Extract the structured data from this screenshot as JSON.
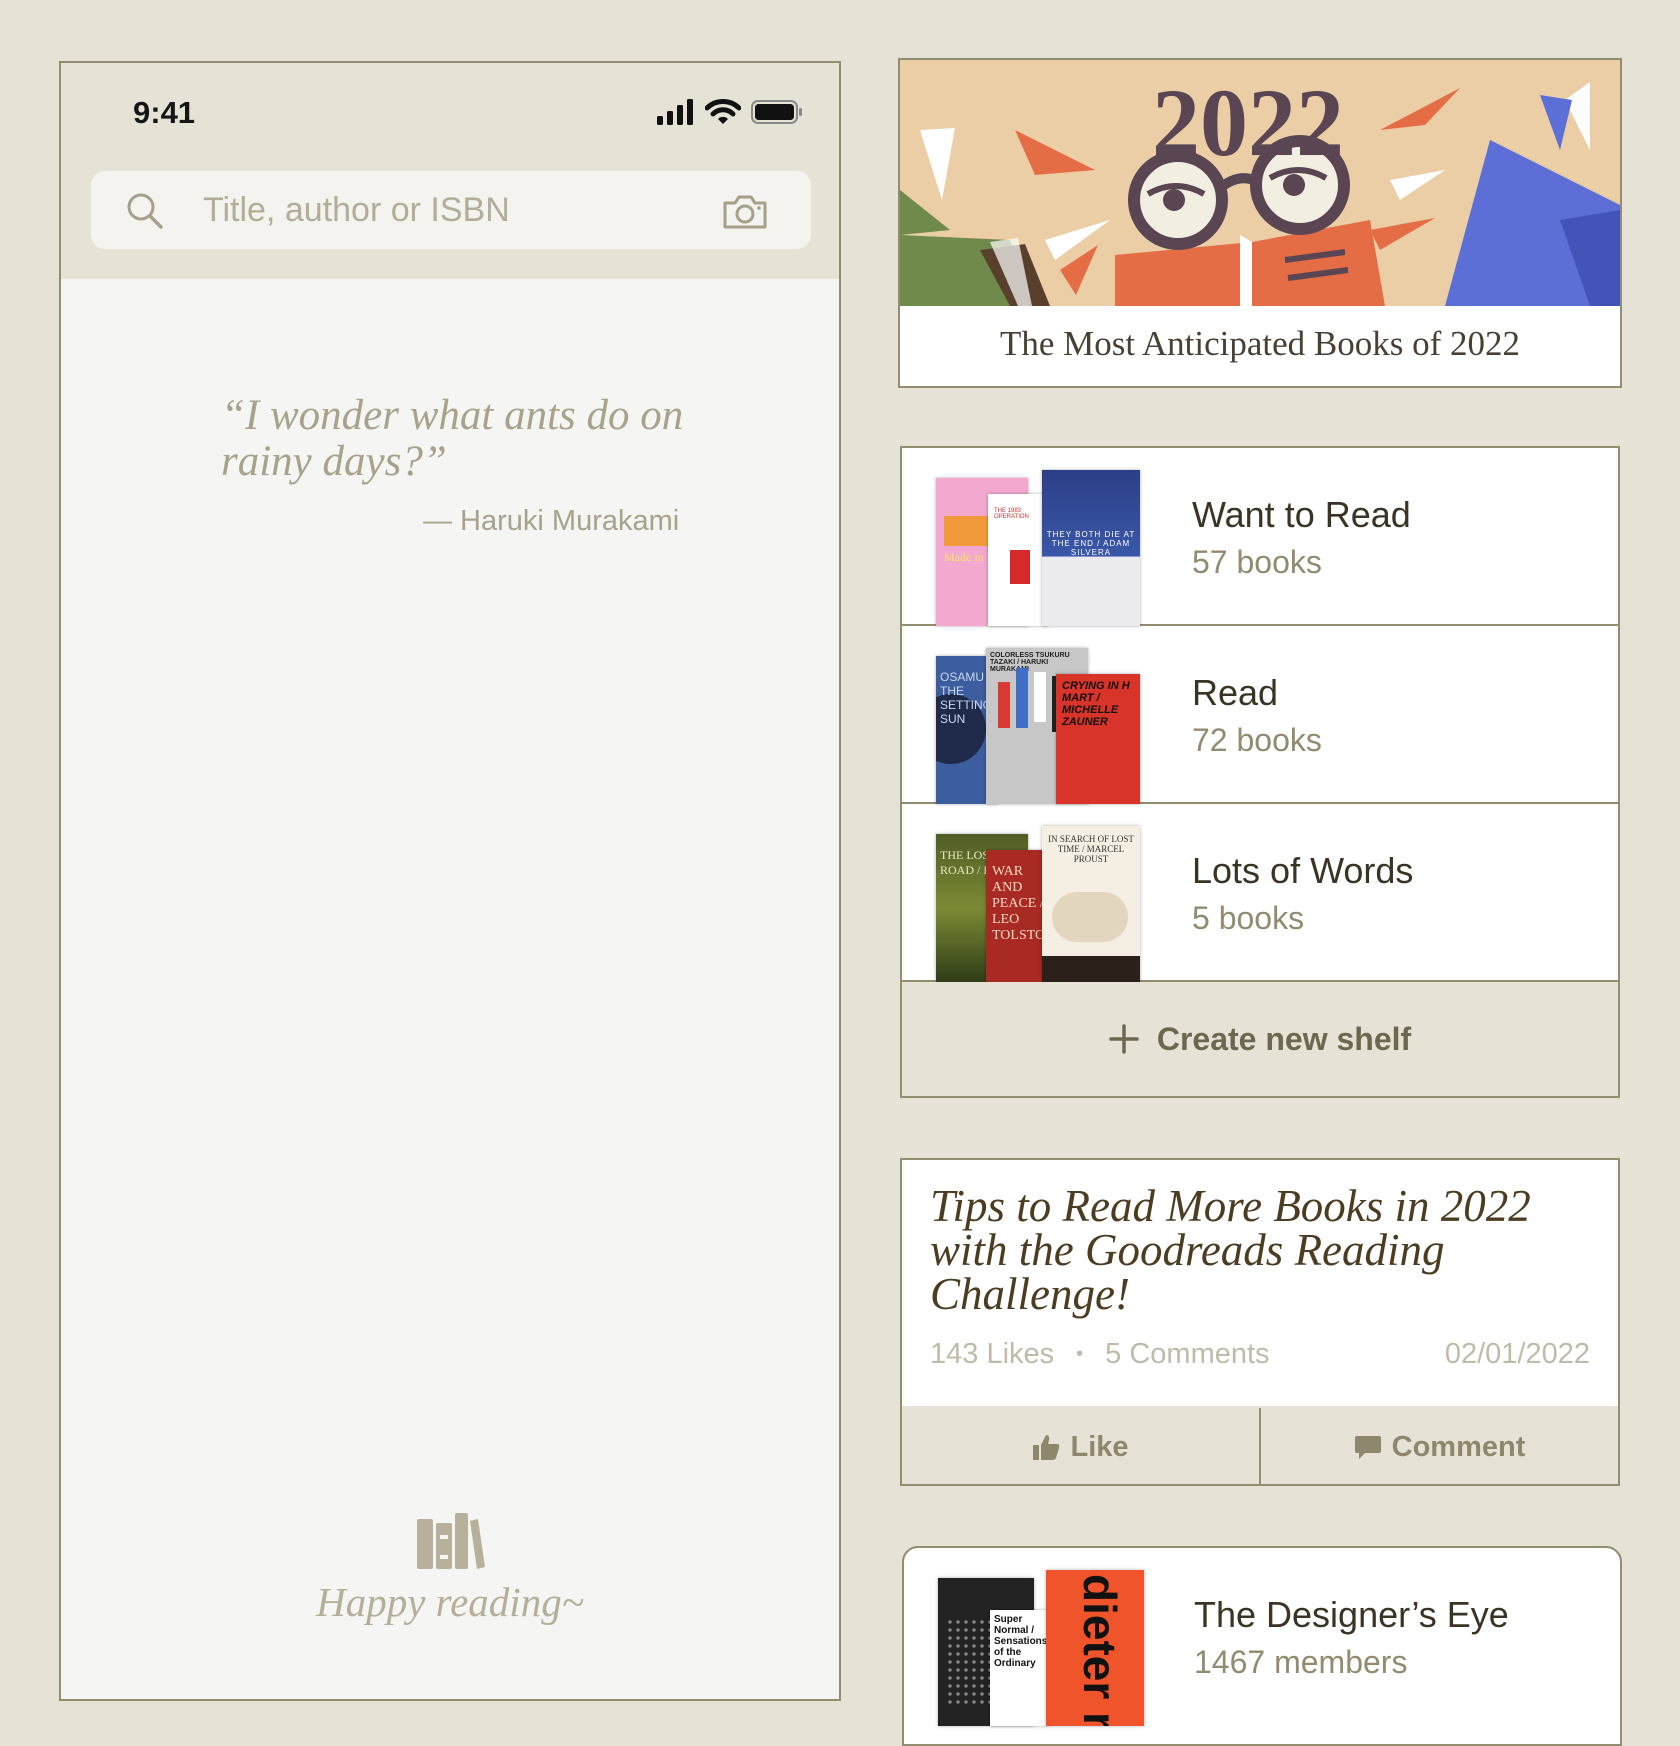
{
  "status_bar": {
    "time": "9:41"
  },
  "search": {
    "placeholder": "Title, author or ISBN"
  },
  "quote": {
    "text": "“I wonder what ants do on rainy days?”",
    "author": "— Haruki Murakami"
  },
  "footer": {
    "label": "Happy reading~"
  },
  "banner": {
    "year": "2022",
    "title": "The Most Anticipated Books of 2022"
  },
  "shelves": [
    {
      "name": "Want to Read",
      "count": "57 books",
      "covers": [
        {
          "text": "Made in North",
          "color": "#f3a8cf"
        },
        {
          "text": "THE 1983 OPERATION",
          "color": "#ffffff"
        },
        {
          "text": "THEY BOTH DIE AT THE END / ADAM SILVERA",
          "color": "#2b3f86"
        }
      ]
    },
    {
      "name": "Read",
      "count": "72 books",
      "covers": [
        {
          "text": "OSAMU / THE SETTING SUN",
          "color": "#3c5d9e"
        },
        {
          "text": "COLORLESS TSUKURU TAZAKI / HARUKI MURAKAMI",
          "color": "#c7c7c7"
        },
        {
          "text": "CRYING IN H MART / MICHELLE ZAUNER",
          "color": "#d8342a"
        }
      ]
    },
    {
      "name": "Lots of Words",
      "count": "5 books",
      "covers": [
        {
          "text": "THE LOST ROAD / DAN W",
          "color": "#4f5e24"
        },
        {
          "text": "WAR AND PEACE / LEO TOLSTOY",
          "color": "#a92a22"
        },
        {
          "text": "IN SEARCH OF LOST TIME / MARCEL PROUST",
          "color": "#f4efe2"
        }
      ]
    }
  ],
  "create_shelf": {
    "label": "Create new shelf"
  },
  "article": {
    "title": "Tips to Read More Books in 2022 with the Goodreads Reading Challenge!",
    "likes": "143 Likes",
    "comments": "5 Comments",
    "date": "02/01/2022",
    "like_label": "Like",
    "comment_label": "Comment"
  },
  "group": {
    "name": "The Designer’s Eye",
    "members": "1467 members",
    "covers": [
      {
        "text": "Super Normal / Sensations of the Ordinary",
        "color": "#222222"
      },
      {
        "text": "dieter rams",
        "color": "#f0542a"
      }
    ]
  },
  "colors": {
    "background": "#e6e3d6",
    "border": "#928c70",
    "accent_text": "#4c3d22",
    "muted_text": "#928b6f"
  }
}
